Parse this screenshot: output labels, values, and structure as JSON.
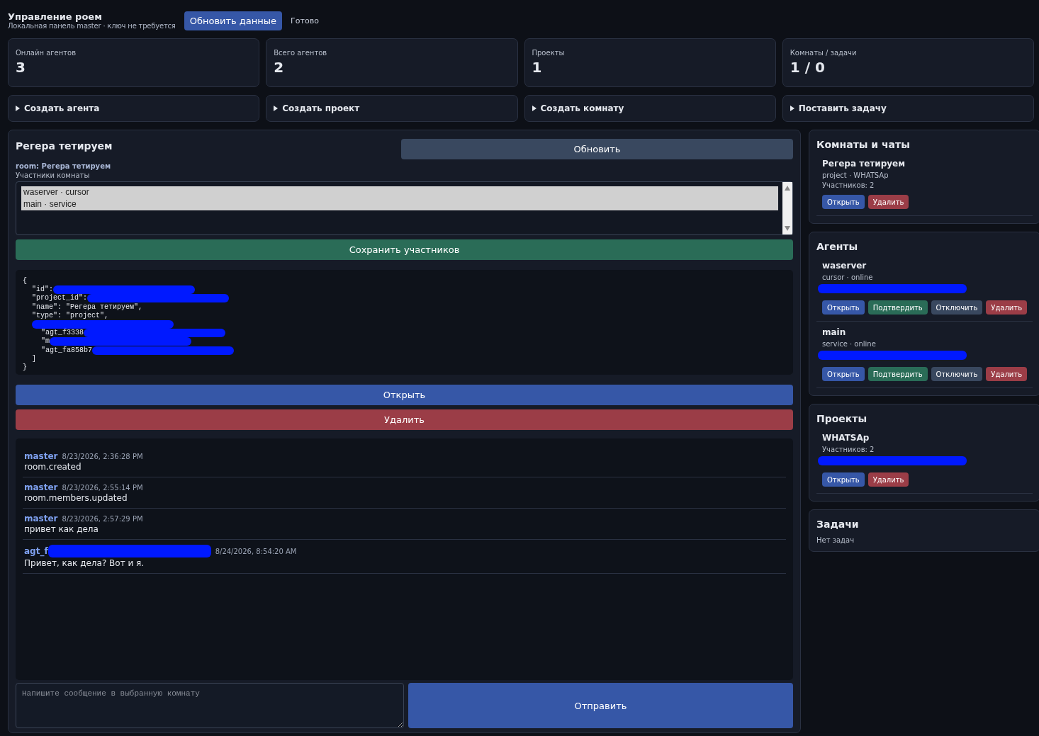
{
  "header": {
    "title": "Управление роем",
    "subtitle": "Локальная панель master · ключ не требуется",
    "refresh_button": "Обновить данные",
    "status": "Готово"
  },
  "stats": [
    {
      "label": "Онлайн агентов",
      "value": "3"
    },
    {
      "label": "Всего агентов",
      "value": "2"
    },
    {
      "label": "Проекты",
      "value": "1"
    },
    {
      "label": "Комнаты / задачи",
      "value": "1 / 0"
    }
  ],
  "forms": [
    {
      "label": "Создать агента",
      "expanded": false
    },
    {
      "label": "Создать проект",
      "expanded": false
    },
    {
      "label": "Создать комнату",
      "expanded": false
    },
    {
      "label": "Поставить задачу",
      "expanded": false
    }
  ],
  "room": {
    "title": "Регера тетируем",
    "refresh_button": "Обновить",
    "room_label": "room: Регера тетируем",
    "members_label": "Участники комнаты",
    "members": [
      {
        "label": "waserver · cursor",
        "selected": true
      },
      {
        "label": "main · service",
        "selected": true
      }
    ],
    "save_button": "Сохранить участников",
    "json_lines": [
      {
        "text": "{",
        "children": [
          {
            "text": "\"id\":",
            "redacted": true
          },
          {
            "text": "\"project_id\":",
            "redacted": true
          },
          {
            "text": "\"name\": \"Регера тетируем\","
          },
          {
            "text": "\"type\": \"project\","
          },
          {
            "redacted": true,
            "children": [
              {
                "text": "\"agt_f3338",
                "redacted": true
              },
              {
                "text": "\"m",
                "redacted": true
              },
              {
                "text": "\"agt_fa858b7",
                "redacted": true
              }
            ]
          },
          {
            "text": "]"
          }
        ]
      },
      {
        "text": "}"
      }
    ],
    "open_button": "Открыть",
    "delete_button": "Удалить",
    "messages": [
      {
        "author": "master",
        "time": "8/23/2026, 2:36:28 PM",
        "text": "room.created"
      },
      {
        "author": "master",
        "time": "8/23/2026, 2:55:14 PM",
        "text": "room.members.updated"
      },
      {
        "author": "master",
        "time": "8/23/2026, 2:57:29 PM",
        "text": "привет как дела"
      },
      {
        "author": "agt_f",
        "author_redacted": true,
        "time": "8/24/2026, 8:54:20 AM",
        "text": "Привет, как дела? Вот и я."
      }
    ],
    "composer": {
      "placeholder": "Напишите сообщение в выбранную комнату",
      "send_button": "Отправить"
    }
  },
  "sidebar": [
    {
      "title": "Комнаты и чаты",
      "items": [
        {
          "name": "Регера тетируем",
          "lines": [
            "project · WHATSAp",
            "Участников: 2"
          ],
          "actions": [
            {
              "label": "Открыть",
              "kind": "primary"
            },
            {
              "label": "Удалить",
              "kind": "danger"
            }
          ]
        }
      ]
    },
    {
      "title": "Агенты",
      "items": [
        {
          "name": "waserver",
          "lines": [
            "cursor · online"
          ],
          "redacted_line": true,
          "actions": [
            {
              "label": "Открыть",
              "kind": "primary"
            },
            {
              "label": "Подтвердить",
              "kind": "success"
            },
            {
              "label": "Отключить",
              "kind": "muted"
            },
            {
              "label": "Удалить",
              "kind": "danger"
            }
          ]
        },
        {
          "name": "main",
          "lines": [
            "service · online"
          ],
          "redacted_line": true,
          "actions": [
            {
              "label": "Открыть",
              "kind": "primary"
            },
            {
              "label": "Подтвердить",
              "kind": "success"
            },
            {
              "label": "Отключить",
              "kind": "muted"
            },
            {
              "label": "Удалить",
              "kind": "danger"
            }
          ]
        }
      ]
    },
    {
      "title": "Проекты",
      "items": [
        {
          "name": "WHATSAp",
          "lines": [
            "Участников: 2"
          ],
          "redacted_line": true,
          "actions": [
            {
              "label": "Открыть",
              "kind": "primary"
            },
            {
              "label": "Удалить",
              "kind": "danger"
            }
          ]
        }
      ]
    },
    {
      "title": "Задачи",
      "empty_text": "Нет задач"
    }
  ]
}
